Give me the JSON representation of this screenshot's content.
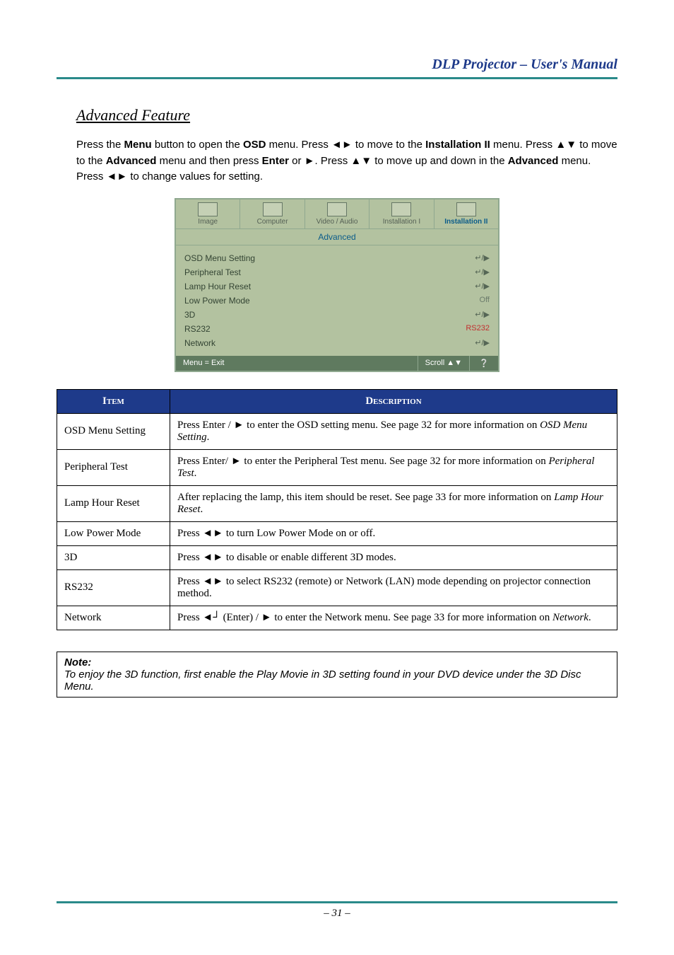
{
  "header": {
    "title": "DLP Projector – User's Manual"
  },
  "section": {
    "heading": "Advanced Feature"
  },
  "intro": {
    "t1": "Press the ",
    "b1": "Menu",
    "t2": " button to open the ",
    "b2": "OSD",
    "t3": " menu. Press ◄► to move to the ",
    "b3": "Installation II",
    "t4": " menu. Press ▲▼ to move to the ",
    "b4": "Advanced",
    "t5": " menu and then press ",
    "b5": "Enter",
    "t6": " or ►. Press ▲▼ to move up and down in the ",
    "b6": "Advanced",
    "t7": " menu. Press ◄► to change values for setting."
  },
  "osd": {
    "tabs": {
      "image": "Image",
      "computer": "Computer",
      "video": "Video / Audio",
      "inst1": "Installation I",
      "inst2": "Installation II"
    },
    "subhead": "Advanced",
    "rows": {
      "osd_menu": {
        "label": "OSD Menu Setting",
        "value": "↵/▶"
      },
      "peripheral": {
        "label": "Peripheral Test",
        "value": "↵/▶"
      },
      "lamp": {
        "label": "Lamp Hour Reset",
        "value": "↵/▶"
      },
      "low_power": {
        "label": "Low Power Mode",
        "value": "Off"
      },
      "three_d": {
        "label": "3D",
        "value": "↵/▶"
      },
      "rs232": {
        "label": "RS232",
        "value": "RS232"
      },
      "network": {
        "label": "Network",
        "value": "↵/▶"
      }
    },
    "footer": {
      "left": "Menu = Exit",
      "right": "Scroll ▲▼",
      "icon": "❔"
    }
  },
  "table": {
    "head": {
      "item": "Item",
      "desc": "Description"
    },
    "rows": [
      {
        "item": "OSD Menu Setting",
        "desc_pre": "Press Enter / ► to enter the OSD setting menu. See page 32 for more information on ",
        "desc_it": "OSD Menu Setting",
        "desc_post": "."
      },
      {
        "item": "Peripheral Test",
        "desc_pre": "Press Enter/ ► to enter the Peripheral Test menu. See page 32 for more information on ",
        "desc_it": "Peripheral Test",
        "desc_post": "."
      },
      {
        "item": "Lamp Hour Reset",
        "desc_pre": "After replacing the lamp, this item should be reset. See page 33 for more information on ",
        "desc_it": "Lamp Hour Reset",
        "desc_post": "."
      },
      {
        "item": "Low Power Mode",
        "desc_pre": "Press ◄► to turn Low Power Mode on or off.",
        "desc_it": "",
        "desc_post": ""
      },
      {
        "item": "3D",
        "desc_pre": "Press ◄► to disable or enable different 3D modes.",
        "desc_it": "",
        "desc_post": ""
      },
      {
        "item": "RS232",
        "desc_pre": "Press ◄► to select RS232 (remote) or Network (LAN) mode depending on projector connection method.",
        "desc_it": "",
        "desc_post": ""
      },
      {
        "item": "Network",
        "desc_pre": "Press ◄┘ (Enter) / ► to enter the Network menu. See page 33 for more information on ",
        "desc_it": "Network",
        "desc_post": "."
      }
    ]
  },
  "note": {
    "label": "Note:",
    "text": "To enjoy the 3D function, first enable the Play Movie in 3D setting found in your DVD device under the 3D Disc Menu."
  },
  "footer": {
    "page": "– 31 –"
  }
}
